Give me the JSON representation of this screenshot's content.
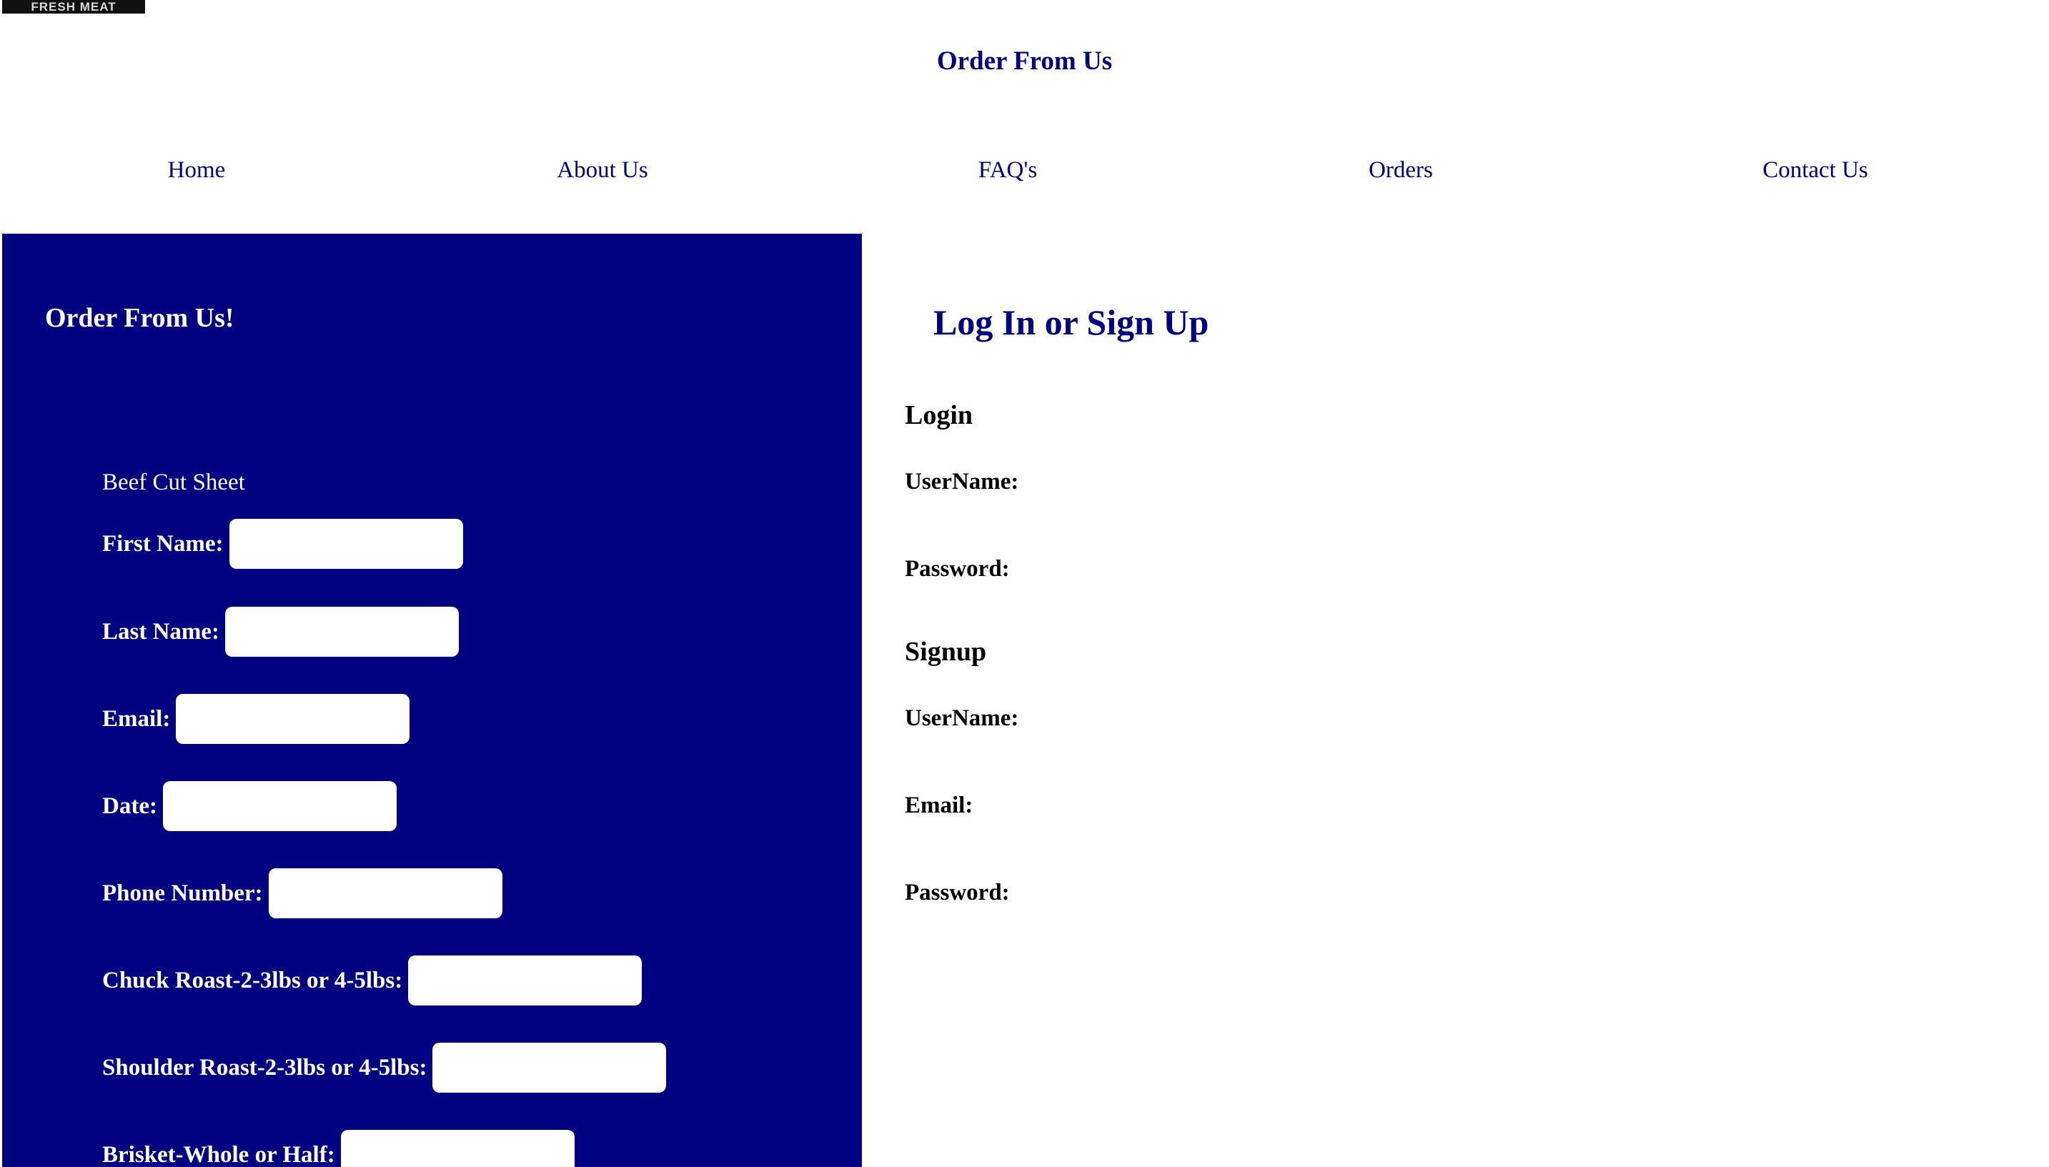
{
  "header": {
    "logo_text": "FRESH MEAT",
    "site_title": "Order From Us"
  },
  "nav": {
    "items": [
      {
        "label": "Home"
      },
      {
        "label": "About Us"
      },
      {
        "label": "FAQ's"
      },
      {
        "label": "Orders"
      },
      {
        "label": "Contact Us"
      }
    ]
  },
  "order_panel": {
    "heading": "Order From Us!",
    "sheet_label": "Beef Cut Sheet",
    "fields": [
      {
        "label": "First Name:",
        "value": ""
      },
      {
        "label": "Last Name:",
        "value": ""
      },
      {
        "label": "Email:",
        "value": ""
      },
      {
        "label": "Date:",
        "value": ""
      },
      {
        "label": "Phone Number:",
        "value": ""
      },
      {
        "label": "Chuck Roast-2-3lbs or 4-5lbs:",
        "value": ""
      },
      {
        "label": "Shoulder Roast-2-3lbs or 4-5lbs:",
        "value": ""
      },
      {
        "label": "Brisket-Whole or Half:",
        "value": ""
      }
    ]
  },
  "auth": {
    "heading": "Log In or Sign Up",
    "login": {
      "heading": "Login",
      "username_label": "UserName:",
      "password_label": "Password:"
    },
    "signup": {
      "heading": "Signup",
      "username_label": "UserName:",
      "email_label": "Email:",
      "password_label": "Password:"
    }
  },
  "colors": {
    "primary": "#000080",
    "background": "#ffffff",
    "panel_text": "#ffffff",
    "body_text": "#000000"
  }
}
